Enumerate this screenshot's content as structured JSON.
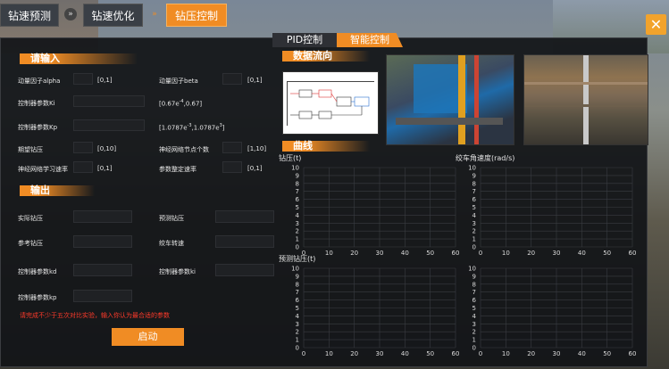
{
  "top_tabs": [
    "钻速预测",
    "钻速优化",
    "钻压控制"
  ],
  "sep_glyph": "»",
  "close_glyph": "✕",
  "sub_tabs": [
    "PID控制",
    "智能控制"
  ],
  "input_section": {
    "header": "请输入",
    "rows": [
      {
        "label": "动量因子alpha",
        "range": "[0,1]"
      },
      {
        "label": "动量因子beta",
        "range": "[0,1]"
      },
      {
        "label": "控制器参数Ki",
        "range_base": "[0.67e",
        "range_sup": "-4",
        "range_tail": ",0.67]"
      },
      {
        "label": "控制器参数Kp",
        "range_base": "[1.0787e",
        "range_sup": "-3",
        "range_mid": ",1.0787e",
        "range_sup2": "3",
        "range_tail": "]"
      },
      {
        "label": "期望钻压",
        "range": "[0,10]"
      },
      {
        "label": "神经网络节点个数",
        "range": "[1,10]"
      },
      {
        "label": "神经网络学习速率",
        "range": "[0,1]"
      },
      {
        "label": "参数整定速率",
        "range": "[0,1]"
      }
    ]
  },
  "output_section": {
    "header": "输出",
    "labels": [
      "实际钻压",
      "预测钻压",
      "参考钻压",
      "绞车转速",
      "控制器参数kd",
      "控制器参数ki",
      "控制器参数kp"
    ]
  },
  "warning": "请完成不少于五次对比实验，输入你认为最合适的参数",
  "start_label": "启动",
  "data_flow_header": "数据流向",
  "curves_header": "曲线",
  "charts": [
    {
      "title": "钻压(t)"
    },
    {
      "title": "绞车角速度(rad/s)"
    },
    {
      "title": "预测钻压(t)"
    },
    {
      "title": ""
    }
  ],
  "chart_data": [
    {
      "type": "line",
      "title": "钻压(t)",
      "x_ticks": [
        0,
        10,
        20,
        30,
        40,
        50,
        60
      ],
      "y_ticks": [
        0,
        1,
        2,
        3,
        4,
        5,
        6,
        7,
        8,
        9,
        10
      ],
      "xlim": [
        0,
        60
      ],
      "ylim": [
        0,
        10
      ],
      "grid": true,
      "series": []
    },
    {
      "type": "line",
      "title": "绞车角速度(rad/s)",
      "x_ticks": [
        0,
        10,
        20,
        30,
        40,
        50,
        60
      ],
      "y_ticks": [
        0,
        1,
        2,
        3,
        4,
        5,
        6,
        7,
        8,
        9,
        10
      ],
      "xlim": [
        0,
        60
      ],
      "ylim": [
        0,
        10
      ],
      "grid": true,
      "series": []
    },
    {
      "type": "line",
      "title": "预测钻压(t)",
      "x_ticks": [
        0,
        10,
        20,
        30,
        40,
        50,
        60
      ],
      "y_ticks": [
        0,
        1,
        2,
        3,
        4,
        5,
        6,
        7,
        8,
        9,
        10
      ],
      "xlim": [
        0,
        60
      ],
      "ylim": [
        0,
        10
      ],
      "grid": true,
      "series": []
    },
    {
      "type": "line",
      "title": "",
      "x_ticks": [
        0,
        10,
        20,
        30,
        40,
        50,
        60
      ],
      "y_ticks": [
        0,
        1,
        2,
        3,
        4,
        5,
        6,
        7,
        8,
        9,
        10
      ],
      "xlim": [
        0,
        60
      ],
      "ylim": [
        0,
        10
      ],
      "grid": true,
      "series": []
    }
  ],
  "colors": {
    "accent": "#f08c24",
    "warning": "#ff3a2a",
    "panel": "#121418",
    "grid": "#3a3d42"
  }
}
